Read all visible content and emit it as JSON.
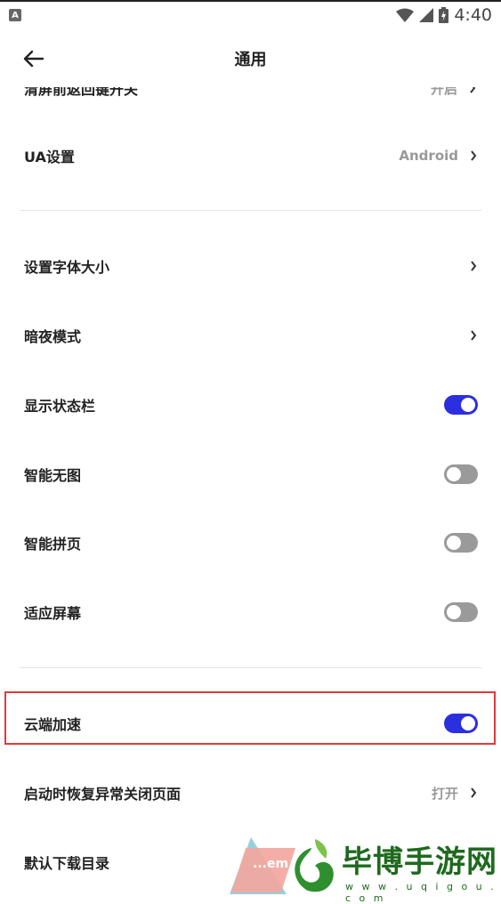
{
  "status_bar": {
    "app_icon_letter": "A",
    "time": "4:40"
  },
  "header": {
    "title": "通用"
  },
  "clipped_row": {
    "label": "清屏前返回键开关",
    "value": "开启"
  },
  "rows": [
    {
      "label": "UA设置",
      "value": "Android",
      "type": "nav"
    },
    {
      "label": "设置字体大小",
      "type": "nav"
    },
    {
      "label": "暗夜模式",
      "type": "nav"
    },
    {
      "label": "显示状态栏",
      "type": "toggle",
      "on": true
    },
    {
      "label": "智能无图",
      "type": "toggle",
      "on": false
    },
    {
      "label": "智能拼页",
      "type": "toggle",
      "on": false
    },
    {
      "label": "适应屏幕",
      "type": "toggle",
      "on": false
    },
    {
      "label": "云端加速",
      "type": "toggle",
      "on": true
    },
    {
      "label": "启动时恢复异常关闭页面",
      "value": "打开",
      "type": "nav"
    },
    {
      "label": "默认下载目录",
      "type": "nav"
    }
  ],
  "colors": {
    "toggle_on": "#2b2fe0",
    "toggle_off": "#9a9a9a",
    "highlight_border": "#e03a3a"
  },
  "watermark": {
    "brand": "毕博手游网",
    "url": "w w w . u q i g o u . c o m",
    "fragment": "...em"
  }
}
